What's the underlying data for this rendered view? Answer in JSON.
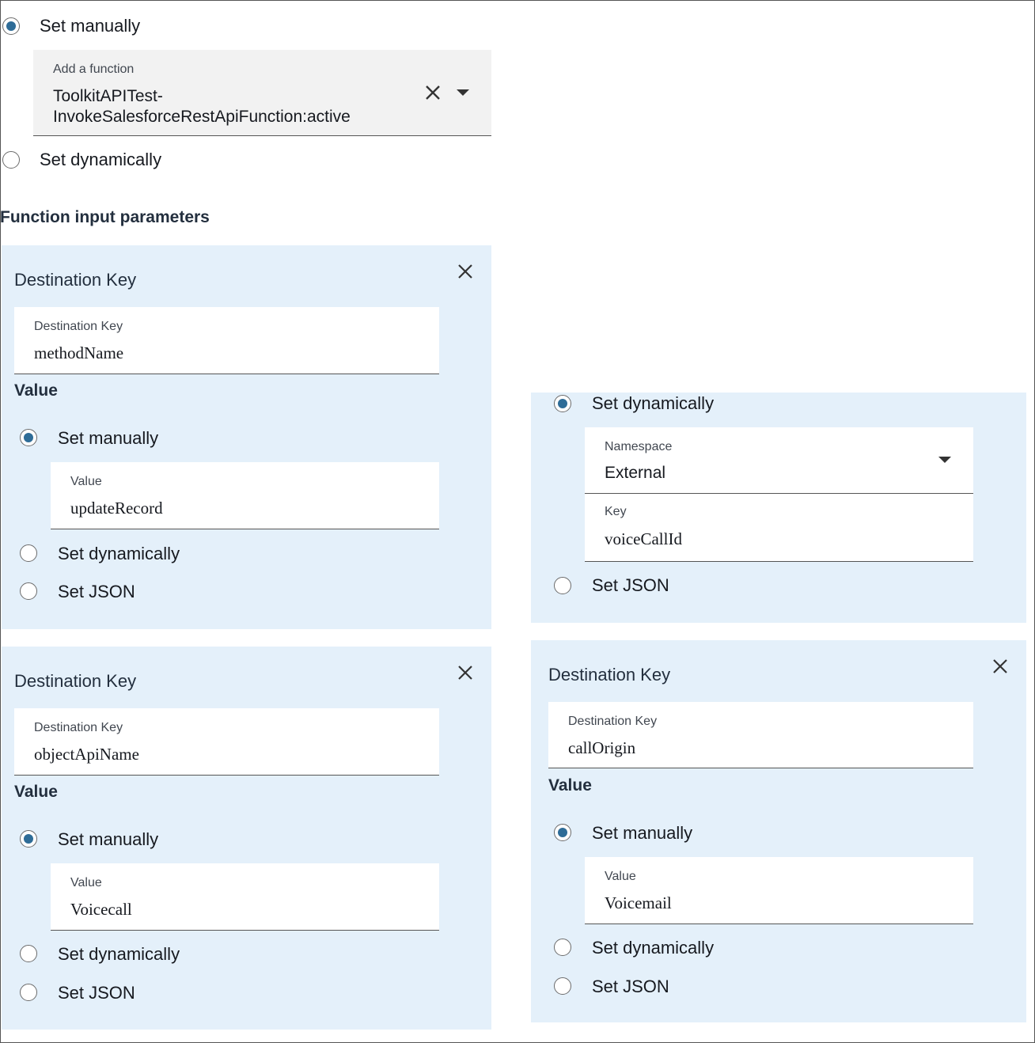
{
  "top": {
    "set_manually": "Set manually",
    "add_function_label": "Add a function",
    "function_line1": "ToolkitAPITest-",
    "function_line2": "InvokeSalesforceRestApiFunction:active",
    "set_dynamically": "Set dynamically"
  },
  "section_title": "Function input parameters",
  "panel1": {
    "title": "Destination Key",
    "key_label": "Destination Key",
    "key_value": "methodName",
    "value_heading": "Value",
    "opt_manual": "Set manually",
    "value_label": "Value",
    "value": "updateRecord",
    "opt_dynamic": "Set dynamically",
    "opt_json": "Set JSON"
  },
  "panel2": {
    "title": "Destination Key",
    "key_label": "Destination Key",
    "key_value": "objectApiName",
    "value_heading": "Value",
    "opt_manual": "Set manually",
    "value_label": "Value",
    "value": "Voicecall",
    "opt_dynamic": "Set dynamically",
    "opt_json": "Set JSON"
  },
  "panel3": {
    "opt_dynamic": "Set dynamically",
    "namespace_label": "Namespace",
    "namespace_value": "External",
    "key_label": "Key",
    "key_value": "voiceCallId",
    "opt_json": "Set JSON"
  },
  "panel4": {
    "title": "Destination Key",
    "key_label": "Destination Key",
    "key_value": "callOrigin",
    "value_heading": "Value",
    "opt_manual": "Set manually",
    "value_label": "Value",
    "value": "Voicemail",
    "opt_dynamic": "Set dynamically",
    "opt_json": "Set JSON"
  }
}
